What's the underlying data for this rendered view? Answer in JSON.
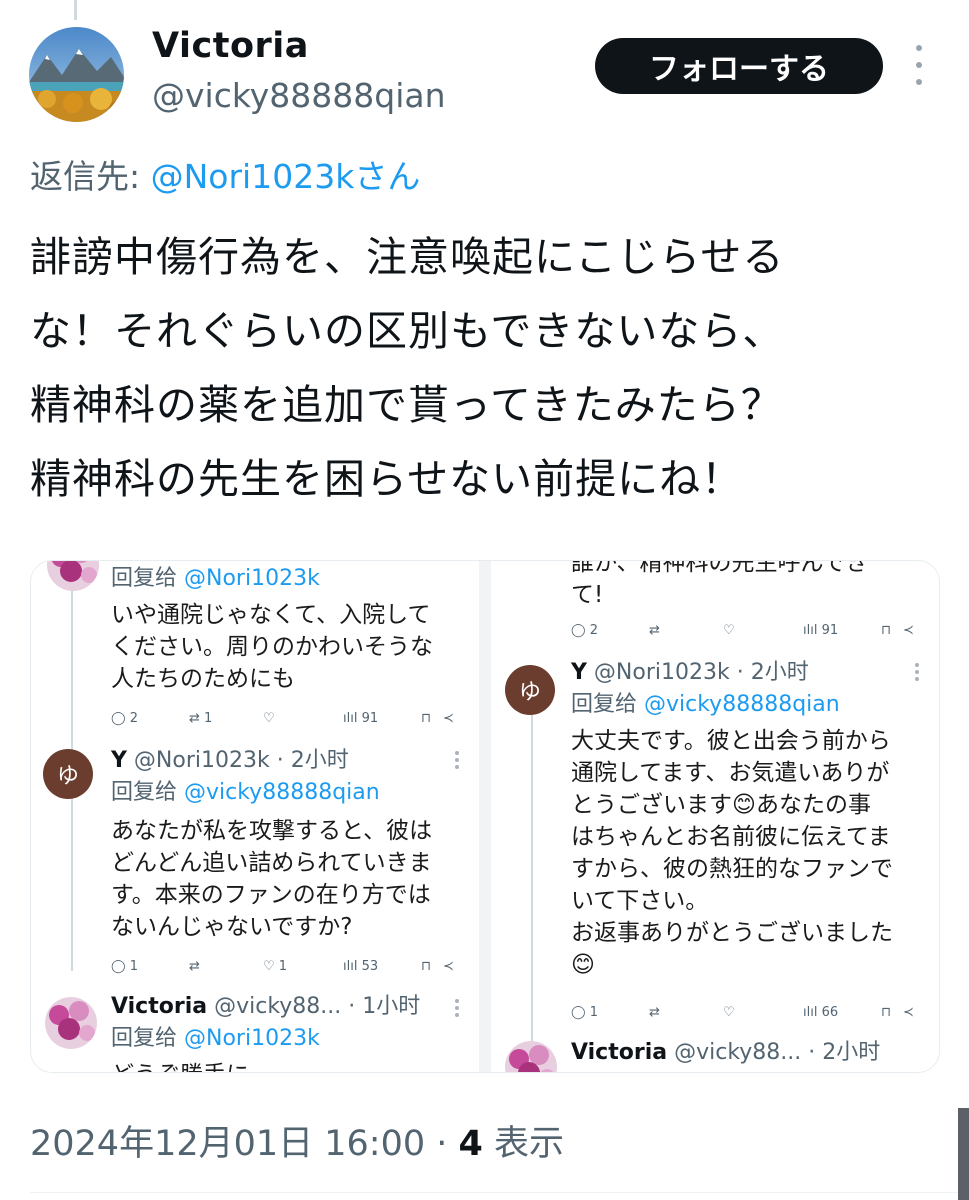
{
  "tweet": {
    "name": "Victoria",
    "handle": "@vicky88888qian",
    "follow_label": "フォローする",
    "reply_prefix": "返信先: ",
    "reply_mention": "@Nori1023kさん",
    "text_lines": [
      "誹謗中傷行為を、注意喚起にこじらせる",
      "な！それぐらいの区別もできないなら、",
      "精神科の薬を追加で貰ってきたみたら？",
      "精神科の先生を困らせない前提にね！"
    ],
    "timestamp": "2024年12月01日 16:00 · ",
    "views_count": "4",
    "views_label": " 表示"
  },
  "media": {
    "left": {
      "reply1_label": "回复给 ",
      "reply1_mention": "@Nori1023k",
      "reply1_body": [
        "いや通院じゃなくて、入院して",
        "ください。周りのかわいそうな",
        "人たちのためにも"
      ],
      "reply1_stats": {
        "replies": "2",
        "retweets": "1",
        "views": "91"
      },
      "y_avatar_letter": "ゆ",
      "y_name": "Y",
      "y_meta": " @Nori1023k · 2小时",
      "y_reply_label": "回复给 ",
      "y_reply_mention": "@vicky88888qian",
      "y_body": [
        "あなたが私を攻撃すると、彼は",
        "どんどん追い詰められていきま",
        "す。本来のファンの在り方では",
        "ないんじゃないですか?"
      ],
      "y_stats": {
        "replies": "1",
        "likes": "1",
        "views": "53"
      },
      "v_name": "Victoria",
      "v_meta": " @vicky88... · 1小时",
      "v_reply_label": "回复给 ",
      "v_reply_mention": "@Nori1023k",
      "v_body_cut": "どうぞ勝手に"
    },
    "right": {
      "top_cut": "誰か、精神科の先生呼んでき",
      "top_end": "て!",
      "top_stats": {
        "replies": "2",
        "views": "91"
      },
      "y_avatar_letter": "ゆ",
      "y_name": "Y",
      "y_meta": " @Nori1023k · 2小时",
      "y_reply_label": "回复给 ",
      "y_reply_mention": "@vicky88888qian",
      "y_body": [
        "大丈夫です。彼と出会う前から",
        "通院してます、お気遣いありが",
        "とうございます😊あなたの事",
        "はちゃんとお名前彼に伝えてま",
        "すから、彼の熱狂的なファンで",
        "いて下さい。",
        "お返事ありがとうございました",
        "😊"
      ],
      "y_stats": {
        "replies": "1",
        "views": "66"
      },
      "v_name": "Victoria",
      "v_meta": " @vicky88... · 2小时"
    }
  }
}
